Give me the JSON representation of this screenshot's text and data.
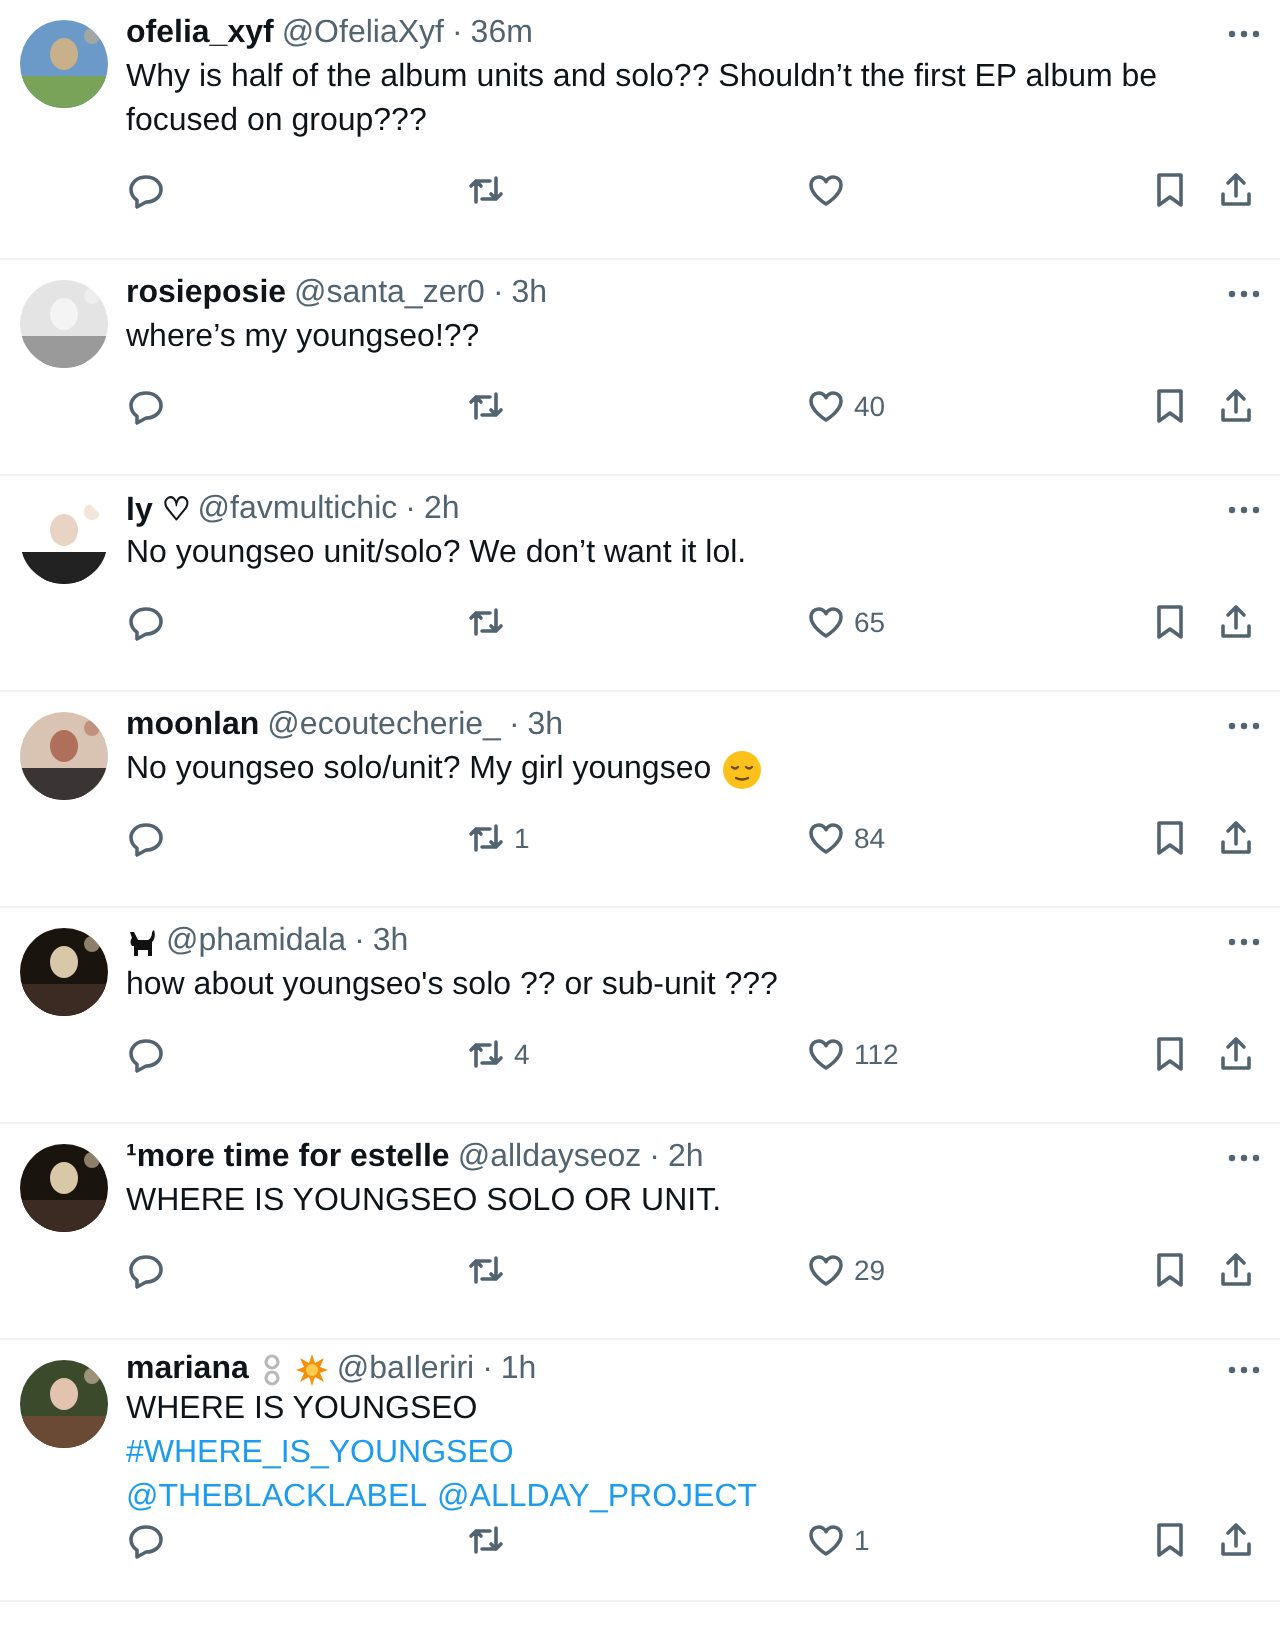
{
  "replies": [
    {
      "name": "ofelia_xyf",
      "handle": "@OfeliaXyf",
      "separator": "·",
      "time": "36m",
      "body": [
        [
          {
            "kind": "text",
            "text": "Why is half of the album units and solo?? Shouldn’t the first EP album be focused on group???"
          }
        ]
      ]
    },
    {
      "name": "rosieposie",
      "handle": "@santa_zer0",
      "separator": "·",
      "time": "3h",
      "body": [
        [
          {
            "kind": "text",
            "text": "where’s my youngseo!??"
          }
        ]
      ],
      "likes": "40"
    },
    {
      "name": "ly ♡",
      "handle": "@favmultichic",
      "separator": "·",
      "time": "2h",
      "body": [
        [
          {
            "kind": "text",
            "text": "No youngseo unit/solo? We don’t want it lol."
          }
        ]
      ],
      "likes": "65"
    },
    {
      "name": "moonlan",
      "handle": "@ecoutecherie_",
      "separator": "·",
      "time": "3h",
      "body": [
        [
          {
            "kind": "text",
            "text": "No youngseo solo/unit? My girl youngseo"
          },
          {
            "kind": "emoji"
          }
        ]
      ],
      "retweets": "1",
      "likes": "84"
    },
    {
      "badges": [
        {
          "kind": "cat"
        }
      ],
      "handle": "@phamidala",
      "separator": "·",
      "time": "3h",
      "body": [
        [
          {
            "kind": "text",
            "text": "how about youngseo's solo ?? or sub-unit ???"
          }
        ]
      ],
      "retweets": "4",
      "likes": "112"
    },
    {
      "name": "¹more time for estelle",
      "handle": "@alldayseoz",
      "separator": "·",
      "time": "2h",
      "body": [
        [
          {
            "kind": "text",
            "text": "WHERE IS YOUNGSEO SOLO OR UNIT."
          }
        ]
      ],
      "likes": "29"
    },
    {
      "name": "mariana",
      "badges": [
        {
          "kind": "chain"
        },
        {
          "kind": "burst"
        }
      ],
      "handle": "@baIleriri",
      "separator": "·",
      "time": "1h",
      "body": [
        [
          {
            "kind": "text",
            "text": "WHERE IS YOUNGSEO"
          }
        ],
        [
          {
            "kind": "link",
            "text": "#WHERE_IS_YOUNGSEO"
          }
        ],
        [
          {
            "kind": "link",
            "text": "@THEBLACKLABEL"
          },
          {
            "kind": "link",
            "text": "@ALLDAY_PROJECT"
          }
        ]
      ],
      "likes": "1"
    }
  ]
}
